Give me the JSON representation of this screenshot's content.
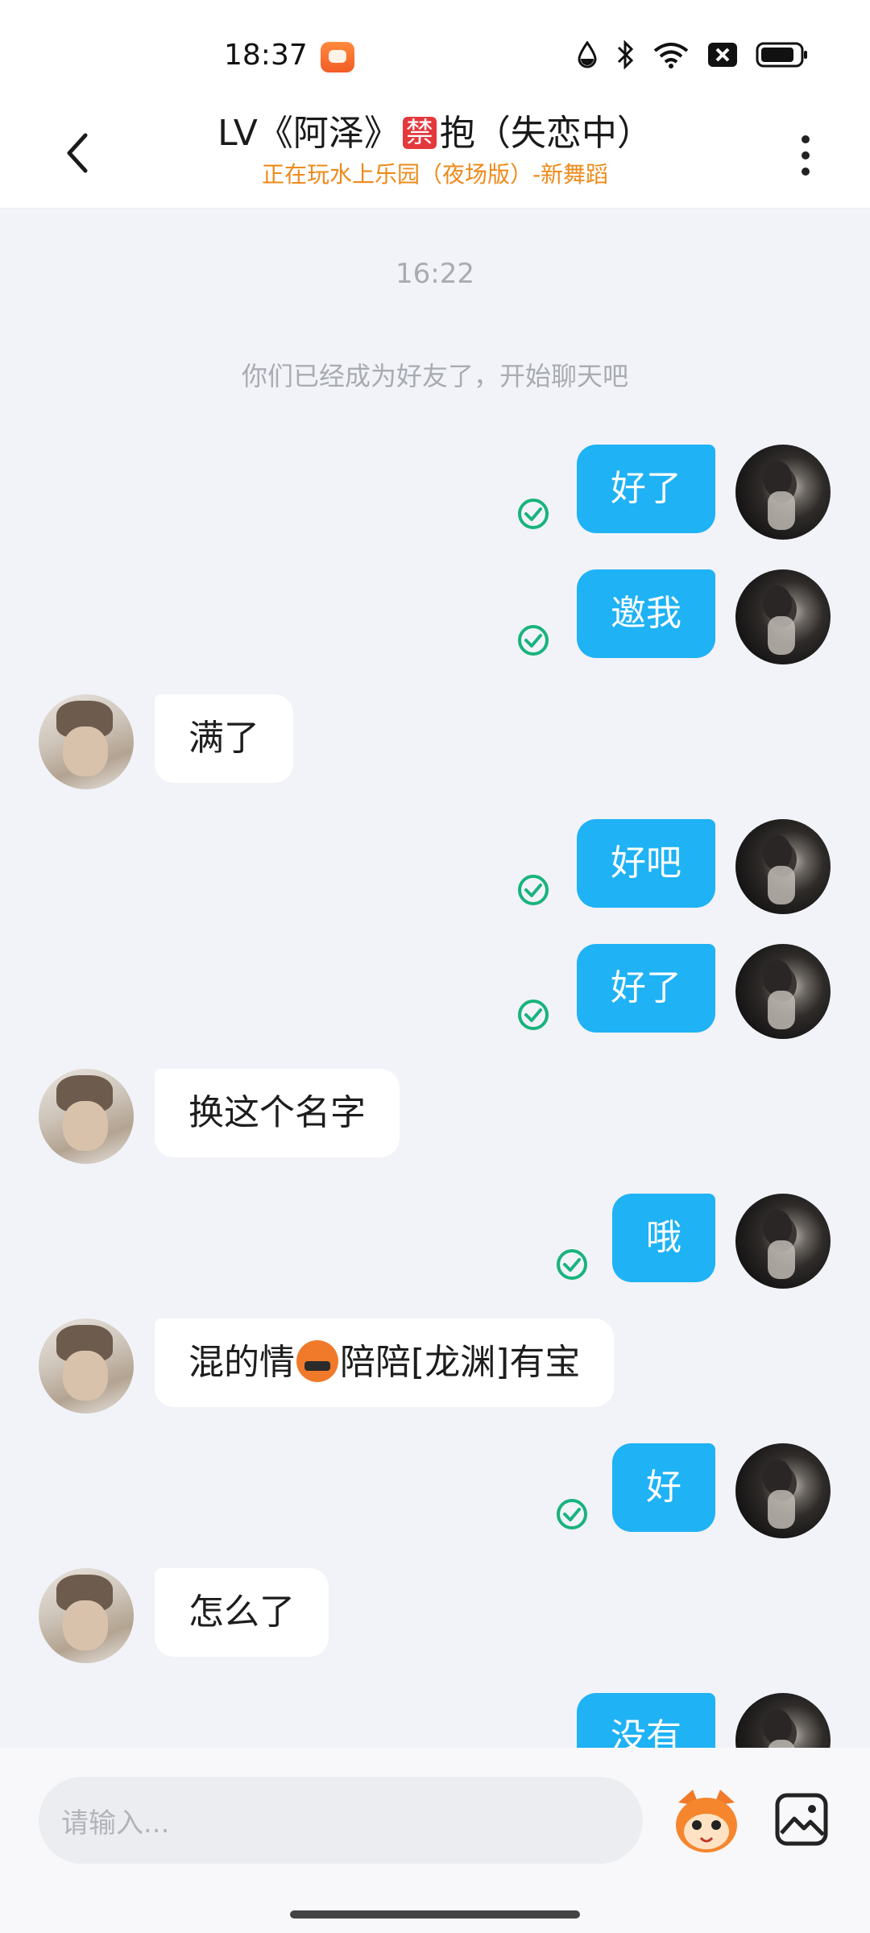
{
  "status_bar": {
    "time": "18:37",
    "icons": [
      "app-badge-icon",
      "water-drop-icon",
      "bluetooth-icon",
      "wifi-icon",
      "sim-off-icon",
      "battery-icon"
    ]
  },
  "header": {
    "title_prefix": "LV《阿泽》",
    "forbid_label": "禁",
    "title_suffix": "抱（失恋中）",
    "subtitle": "正在玩水上乐园（夜场版）-新舞蹈"
  },
  "chat": {
    "timestamp": "16:22",
    "system_message": "你们已经成为好友了，开始聊天吧",
    "messages": [
      {
        "side": "me",
        "text": "好了",
        "delivered": true
      },
      {
        "side": "me",
        "text": "邀我",
        "delivered": true
      },
      {
        "side": "them",
        "text": "满了"
      },
      {
        "side": "me",
        "text": "好吧",
        "delivered": true
      },
      {
        "side": "me",
        "text": "好了",
        "delivered": true
      },
      {
        "side": "them",
        "text": "换这个名字"
      },
      {
        "side": "me",
        "text": "哦",
        "delivered": true
      },
      {
        "side": "them",
        "text_before": "混的情",
        "emoji": "cursing-face-emoji",
        "text_after": "陪陪[龙渊]有宝"
      },
      {
        "side": "me",
        "text": "好",
        "delivered": true
      },
      {
        "side": "them",
        "text": "怎么了"
      },
      {
        "side": "me",
        "text": "没有",
        "delivered": true
      }
    ]
  },
  "input_bar": {
    "placeholder": "请输入...",
    "mascot_icon": "mascot-emoji-icon",
    "image_icon": "image-picker-icon"
  },
  "colors": {
    "my_bubble": "#1fb2f5",
    "their_bubble": "#ffffff",
    "chat_background": "#f1f3f8",
    "subtitle": "#ee8a1b",
    "delivered_check": "#19b37d",
    "forbid_badge": "#e4393c"
  }
}
